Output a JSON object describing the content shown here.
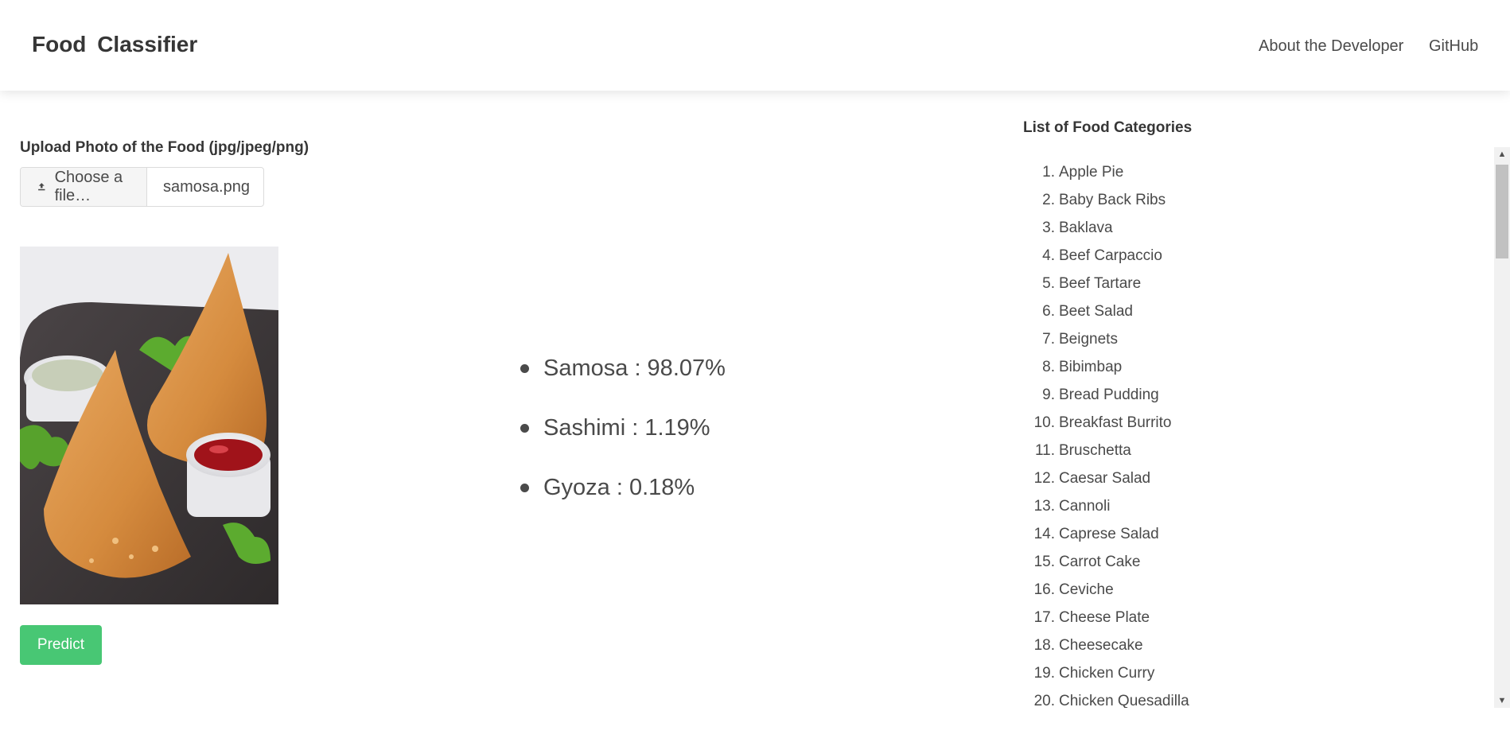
{
  "navbar": {
    "brand": "Food  Classifier",
    "links": [
      "About the Developer",
      "GitHub"
    ]
  },
  "upload": {
    "label": "Upload Photo of the Food (jpg/jpeg/png)",
    "choose_label": "Choose a file…",
    "file_name": "samosa.png"
  },
  "predict_button": "Predict",
  "predictions": [
    {
      "text": "Samosa : 98.07%"
    },
    {
      "text": "Sashimi : 1.19%"
    },
    {
      "text": "Gyoza : 0.18%"
    }
  ],
  "categories": {
    "title": "List of Food Categories",
    "items": [
      {
        "num": "1.",
        "name": "Apple Pie"
      },
      {
        "num": "2.",
        "name": "Baby Back Ribs"
      },
      {
        "num": "3.",
        "name": "Baklava"
      },
      {
        "num": "4.",
        "name": "Beef Carpaccio"
      },
      {
        "num": "5.",
        "name": "Beef Tartare"
      },
      {
        "num": "6.",
        "name": "Beet Salad"
      },
      {
        "num": "7.",
        "name": "Beignets"
      },
      {
        "num": "8.",
        "name": "Bibimbap"
      },
      {
        "num": "9.",
        "name": "Bread Pudding"
      },
      {
        "num": "10.",
        "name": "Breakfast Burrito"
      },
      {
        "num": "11.",
        "name": "Bruschetta"
      },
      {
        "num": "12.",
        "name": "Caesar Salad"
      },
      {
        "num": "13.",
        "name": "Cannoli"
      },
      {
        "num": "14.",
        "name": "Caprese Salad"
      },
      {
        "num": "15.",
        "name": "Carrot Cake"
      },
      {
        "num": "16.",
        "name": "Ceviche"
      },
      {
        "num": "17.",
        "name": "Cheese Plate"
      },
      {
        "num": "18.",
        "name": "Cheesecake"
      },
      {
        "num": "19.",
        "name": "Chicken Curry"
      },
      {
        "num": "20.",
        "name": "Chicken Quesadilla"
      }
    ]
  },
  "colors": {
    "primary_button": "#48c774",
    "text": "#4a4a4a"
  }
}
